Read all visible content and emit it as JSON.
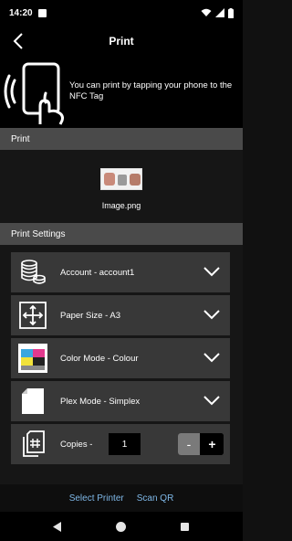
{
  "status_bar": {
    "time": "14:20"
  },
  "app_bar": {
    "title": "Print"
  },
  "nfc": {
    "message": "You can print by tapping your phone to the NFC Tag"
  },
  "print_section": {
    "header": "Print",
    "file_name": "Image.png"
  },
  "settings_section": {
    "header": "Print Settings",
    "account_label": "Account - account1",
    "paper_size_label": "Paper Size - A3",
    "color_mode_label": "Color Mode - Colour",
    "plex_mode_label": "Plex Mode - Simplex",
    "copies_label": "Copies -",
    "copies_value": "1",
    "minus_label": "-",
    "plus_label": "+"
  },
  "bottom_links": {
    "select_printer": "Select Printer",
    "scan_qr": "Scan QR"
  },
  "icons": [
    "back-arrow-icon",
    "nfc-phone-icon",
    "coins-stack-icon",
    "paper-size-icon",
    "color-mode-icon",
    "plex-mode-icon",
    "copies-icon",
    "chevron-down-icon"
  ],
  "colors": {
    "link": "#7fb8e8",
    "section_header": "#4a4a4a",
    "row_bg": "#383838"
  }
}
